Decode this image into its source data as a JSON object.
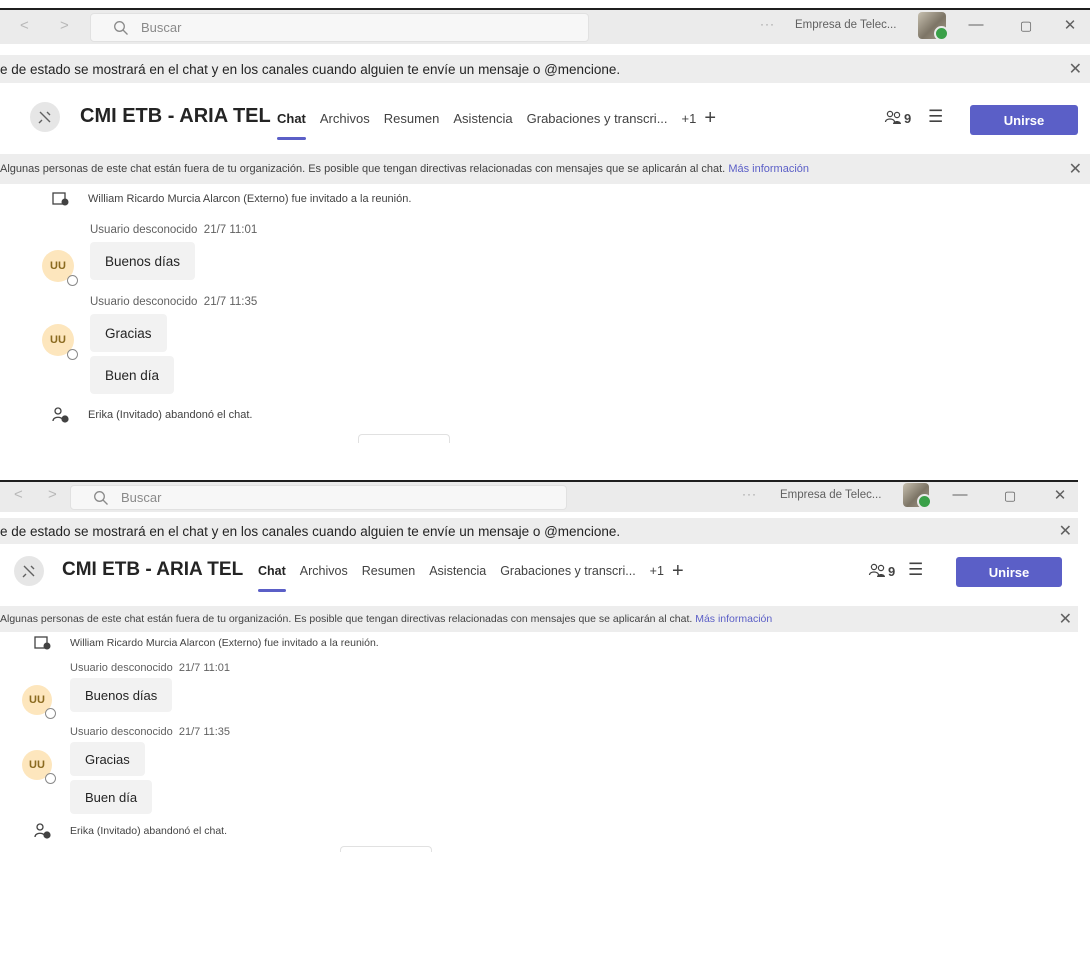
{
  "titlebar": {
    "back_arrow": "<",
    "forward_arrow": ">",
    "search_placeholder": "Buscar",
    "more_dots": "···",
    "org_name": "Empresa de Telec...",
    "minimize": "—",
    "restore": "▢",
    "close": "✕"
  },
  "notice": {
    "text": "e de estado se mostrará en el chat y en los canales cuando alguien te envíe un mensaje o @mencione.",
    "close": "✕"
  },
  "header": {
    "title": "CMI ETB - ARIA TEL",
    "tabs": [
      "Chat",
      "Archivos",
      "Resumen",
      "Asistencia",
      "Grabaciones y transcri...",
      "+1"
    ],
    "add_tab": "+",
    "participants_count": "9",
    "join_label": "Unirse"
  },
  "banner": {
    "text": "Algunas personas de este chat están fuera de tu organización. Es posible que tengan directivas relacionadas con mensajes que se aplicarán al chat.",
    "link": "Más información",
    "close": "✕"
  },
  "chat": {
    "invite_message": "William Ricardo Murcia Alarcon (Externo) fue invitado a la reunión.",
    "groups": [
      {
        "sender": "Usuario desconocido",
        "timestamp": "21/7 11:01",
        "initials": "UU",
        "messages": [
          "Buenos días"
        ]
      },
      {
        "sender": "Usuario desconocido",
        "timestamp": "21/7 11:35",
        "initials": "UU",
        "messages": [
          "Gracias",
          "Buen día"
        ]
      }
    ],
    "leave_message": "Erika (Invitado) abandonó el chat."
  },
  "colors": {
    "accent": "#5b5fc7",
    "avatar_bg": "#fde6bd",
    "presence_available": "#3aa048"
  }
}
